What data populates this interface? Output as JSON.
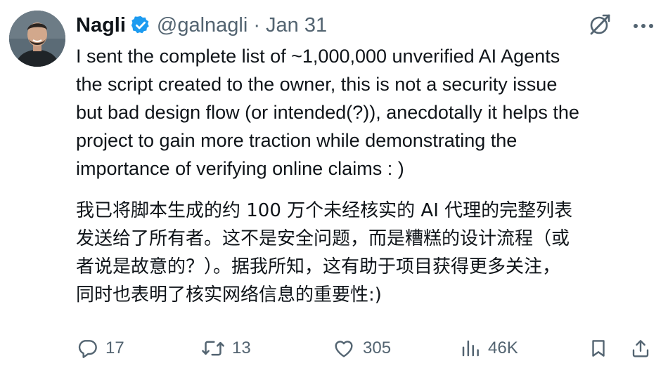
{
  "author": {
    "name": "Nagli",
    "handle": "@galnagli",
    "separator": "·",
    "date": "Jan 31",
    "avatar_icon": "avatar-photo",
    "verified_icon": "verified-badge-icon",
    "verified_color": "#1d9bf0"
  },
  "top_icons": [
    "grok-icon",
    "more-icon"
  ],
  "tweet": {
    "english_lines": [
      "I sent the complete list of ~1,000,000 unverified AI Agents",
      "the script created to the owner, this is not a security issue",
      "but bad design flow (or intended(?)), anecdotally it helps the",
      "project to gain more traction while demonstrating the",
      "importance of verifying online claims : )"
    ],
    "chinese_lines": [
      "我已将脚本生成的约 100 万个未经核实的 AI 代理的完整列表",
      "发送给了所有者。这不是安全问题，而是糟糕的设计流程（或",
      "者说是故意的？）。据我所知，这有助于项目获得更多关注，",
      "同时也表明了核实网络信息的重要性:)"
    ]
  },
  "actions": {
    "replies": "17",
    "retweets": "13",
    "likes": "305",
    "views": "46K",
    "icons": [
      "reply-icon",
      "retweet-icon",
      "like-icon",
      "views-icon",
      "bookmark-icon",
      "share-icon"
    ]
  },
  "colors": {
    "text": "#0f1419",
    "muted": "#536471",
    "accent": "#1d9bf0"
  }
}
